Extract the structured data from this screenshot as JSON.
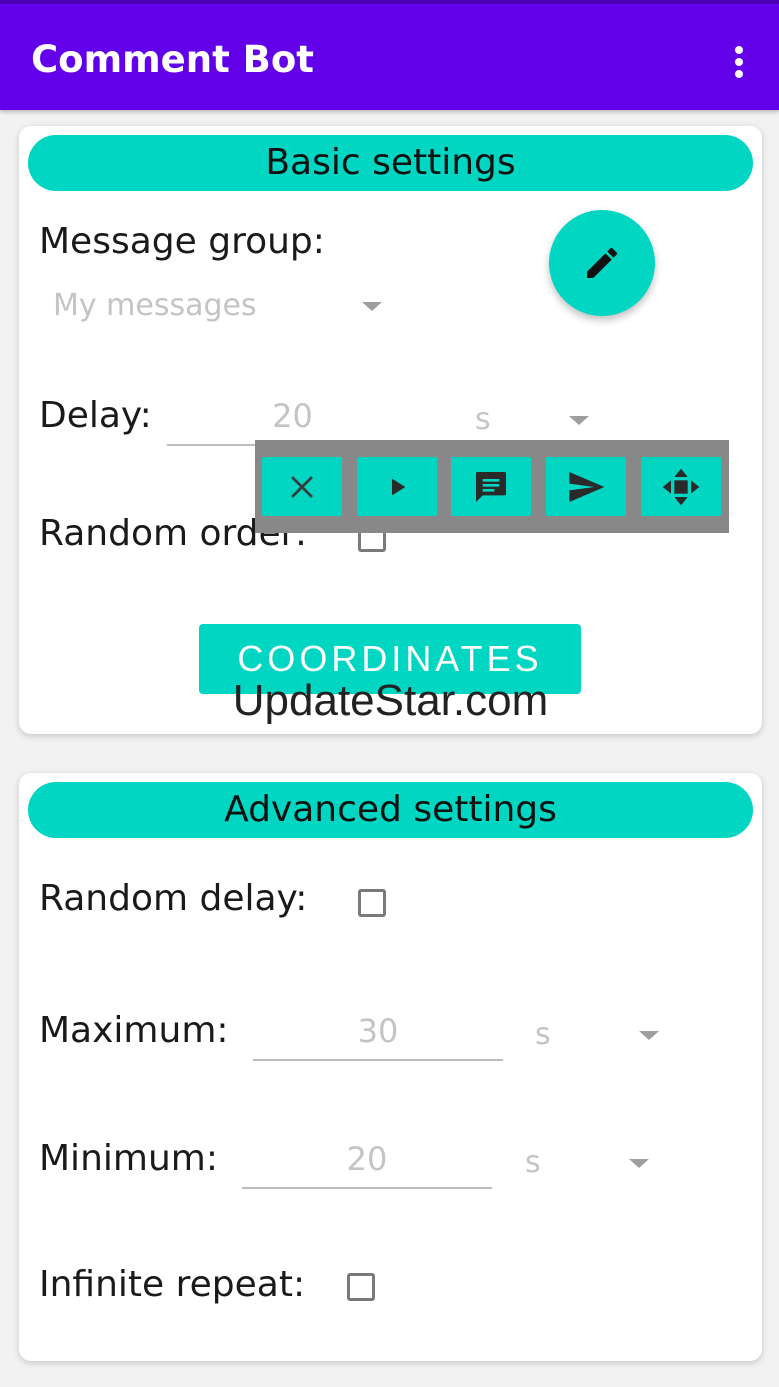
{
  "appbar": {
    "title": "Comment Bot",
    "menu_icon": "more-vert-icon"
  },
  "basic": {
    "header": "Basic settings",
    "message_group_label": "Message group:",
    "message_group_value": "My messages",
    "edit_icon": "pencil-icon",
    "delay_label": "Delay:",
    "delay_value": "20",
    "delay_unit": "s",
    "random_order_label": "Random order:",
    "random_order_checked": false,
    "coordinates_button": "COORDINATES"
  },
  "overlay_toolbar": {
    "buttons": [
      {
        "icon": "close-icon"
      },
      {
        "icon": "play-icon"
      },
      {
        "icon": "message-icon"
      },
      {
        "icon": "send-icon"
      },
      {
        "icon": "move-icon"
      }
    ],
    "background": "#888888",
    "accent": "#00d6c2"
  },
  "watermark": "UpdateStar.com",
  "advanced": {
    "header": "Advanced settings",
    "random_delay_label": "Random delay:",
    "random_delay_checked": false,
    "maximum_label": "Maximum:",
    "maximum_value": "30",
    "maximum_unit": "s",
    "minimum_label": "Minimum:",
    "minimum_value": "20",
    "minimum_unit": "s",
    "infinite_repeat_label": "Infinite repeat:",
    "infinite_repeat_checked": false
  },
  "colors": {
    "primary": "#6200ea",
    "accent": "#00d6c2"
  }
}
